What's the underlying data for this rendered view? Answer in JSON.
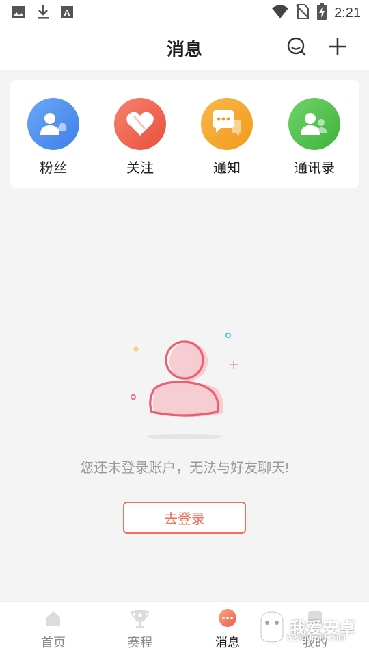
{
  "status_bar": {
    "time": "2:21"
  },
  "header": {
    "title": "消息"
  },
  "quick_entries": [
    {
      "label": "粉丝",
      "color": "#4a8ff0",
      "icon": "user-icon"
    },
    {
      "label": "关注",
      "color": "#f0604d",
      "icon": "heart-icon"
    },
    {
      "label": "通知",
      "color": "#f5a623",
      "icon": "chat-bubble-icon"
    },
    {
      "label": "通讯录",
      "color": "#4fc54f",
      "icon": "contacts-icon"
    }
  ],
  "empty_state": {
    "message": "您还未登录账户，无法与好友聊天!",
    "login_label": "去登录"
  },
  "tabbar": {
    "items": [
      {
        "label": "首页",
        "icon": "home-icon",
        "active": false
      },
      {
        "label": "赛程",
        "icon": "trophy-icon",
        "active": false
      },
      {
        "label": "消息",
        "icon": "message-icon",
        "active": true
      },
      {
        "label": "我的",
        "icon": "profile-icon",
        "active": false
      }
    ]
  },
  "watermark": {
    "text": "我爱安卓",
    "url": "52android.com"
  },
  "colors": {
    "accent": "#ef6f5c",
    "background": "#f4f4f4"
  }
}
